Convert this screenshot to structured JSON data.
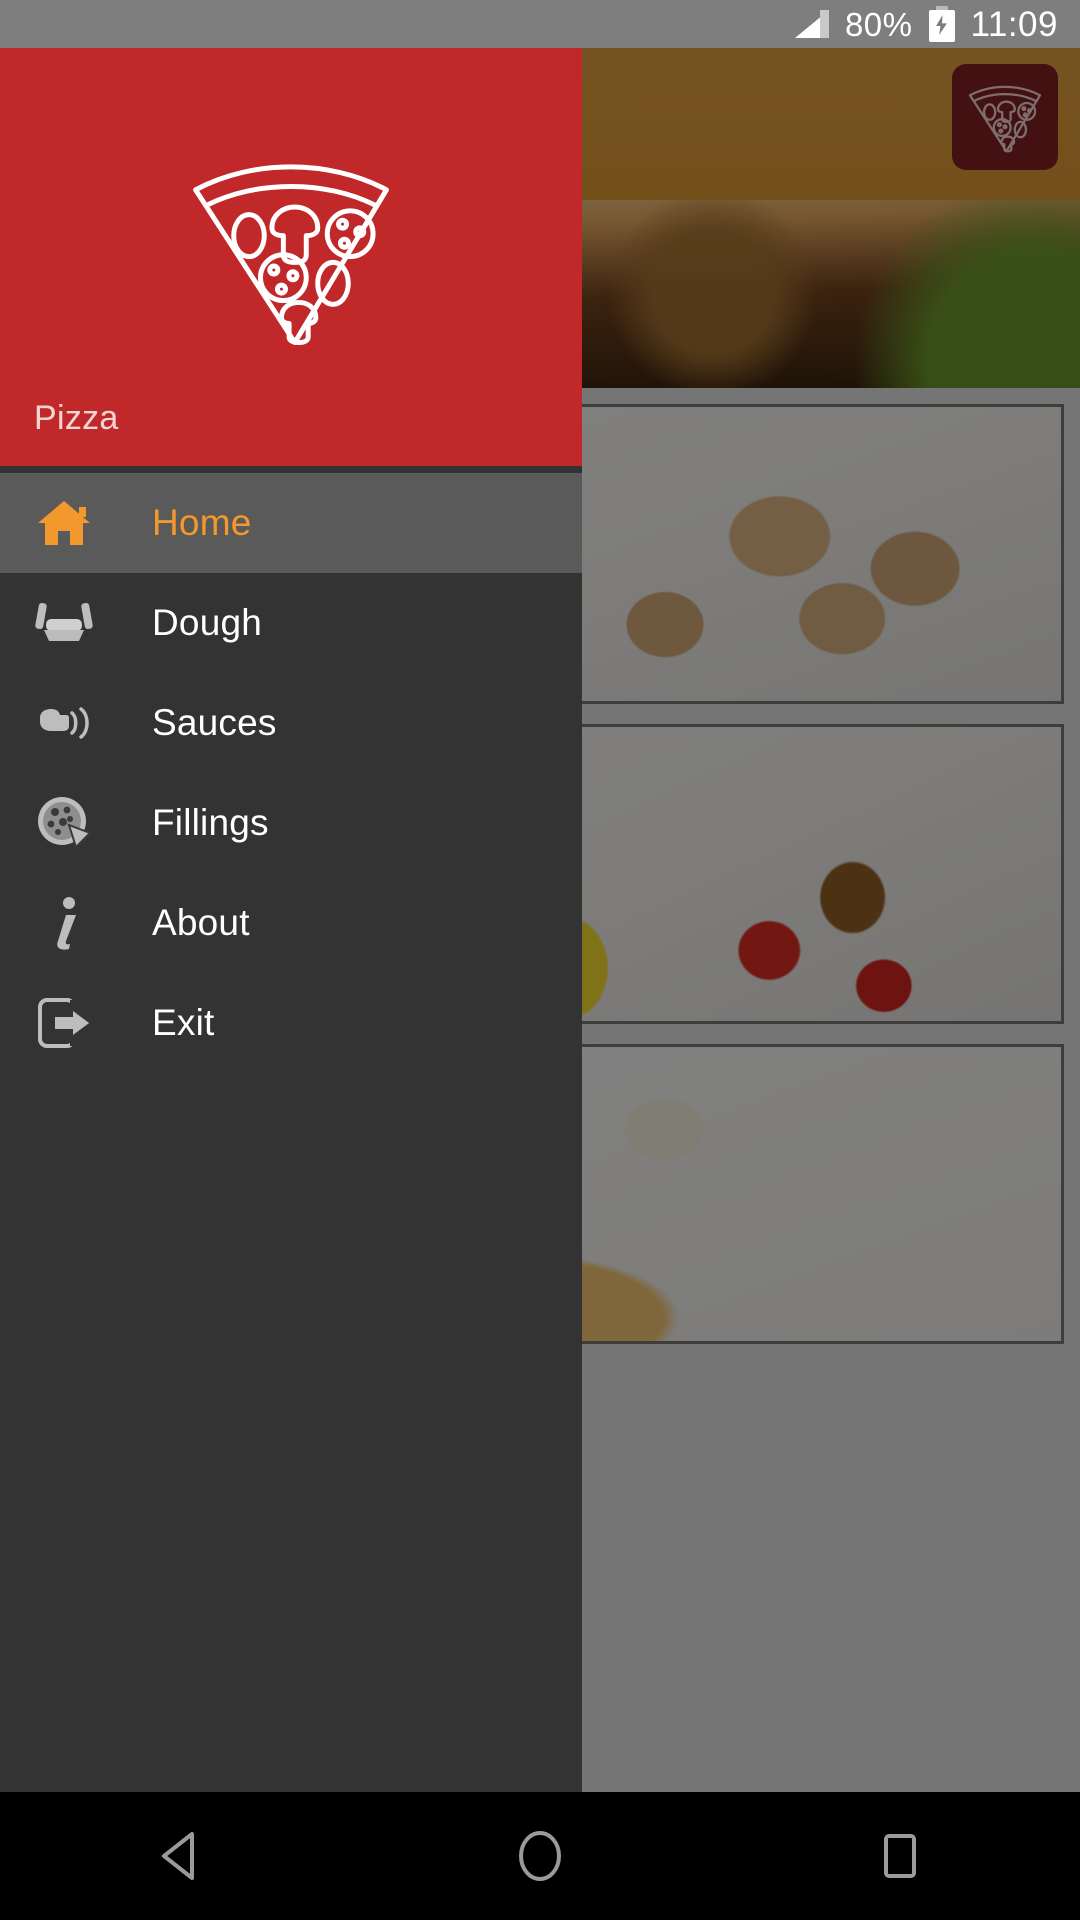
{
  "status_bar": {
    "signal_icon": "signal-triangle-icon",
    "battery_percent": "80%",
    "battery_icon": "battery-charging-icon",
    "time": "11:09"
  },
  "drawer": {
    "header": {
      "title": "Pizza",
      "logo_icon": "pizza-slice-icon",
      "background_color": "#c0282a",
      "title_color": "#f2d6d3"
    },
    "menu_items": [
      {
        "label": "Home",
        "icon": "home-icon",
        "active": true
      },
      {
        "label": "Dough",
        "icon": "dough-icon",
        "active": false
      },
      {
        "label": "Sauces",
        "icon": "sauce-icon",
        "active": false
      },
      {
        "label": "Fillings",
        "icon": "pizza-wheel-icon",
        "active": false
      },
      {
        "label": "About",
        "icon": "info-icon",
        "active": false
      },
      {
        "label": "Exit",
        "icon": "exit-icon",
        "active": false
      }
    ],
    "active_color": "#f3982c",
    "active_row_background": "#5a5a5a",
    "background_color": "#333333"
  },
  "app_content": {
    "hero": {
      "logo_badge_icon": "pizza-slice-icon",
      "badge_color": "#7a1f1f",
      "overlay_color": "#d89a3e"
    },
    "cards": [
      {
        "image_name": "mushrooms-and-flour-scoop-photo"
      },
      {
        "image_name": "rolling-pin-olive-oil-tomatoes-photo"
      },
      {
        "image_name": "pizza-with-tomatoes-and-olives-photo"
      }
    ]
  },
  "nav_bar": {
    "buttons": [
      {
        "name": "back-button",
        "icon": "back-triangle-icon"
      },
      {
        "name": "home-button",
        "icon": "home-circle-icon"
      },
      {
        "name": "recents-button",
        "icon": "recents-square-icon"
      }
    ]
  }
}
